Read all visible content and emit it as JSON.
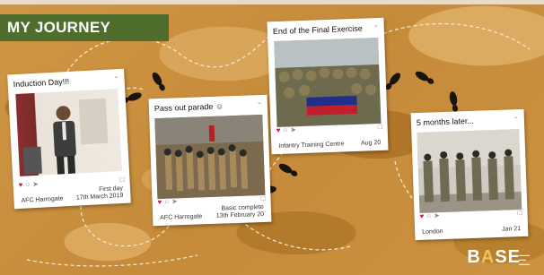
{
  "header": {
    "title": "MY JOURNEY"
  },
  "cards": [
    {
      "caption": "Induction Day!!!",
      "location": "AFC Harrogate",
      "note": "First day",
      "date": "17th March 2019"
    },
    {
      "caption": "Pass out parade ☺",
      "location": "AFC Harrogate",
      "note": "Basic complete",
      "date": "13th February 20"
    },
    {
      "caption": "End of the Final Exercise",
      "location": "Infantry Training Centre",
      "note": "",
      "date": "Aug 20"
    },
    {
      "caption": "5 months later...",
      "location": "London",
      "note": "",
      "date": "Jan 21"
    }
  ],
  "icons": {
    "heart": "heart-icon",
    "comment": "comment-icon",
    "share": "share-icon",
    "bookmark": "bookmark-icon",
    "footprint": "boot-print-icon"
  },
  "logo": {
    "text_part1": "B",
    "text_accent": "A",
    "text_part2": "SE"
  },
  "colors": {
    "title_bar": "#4f6e2e",
    "background": "#c98f3e",
    "heart": "#c0283a"
  }
}
